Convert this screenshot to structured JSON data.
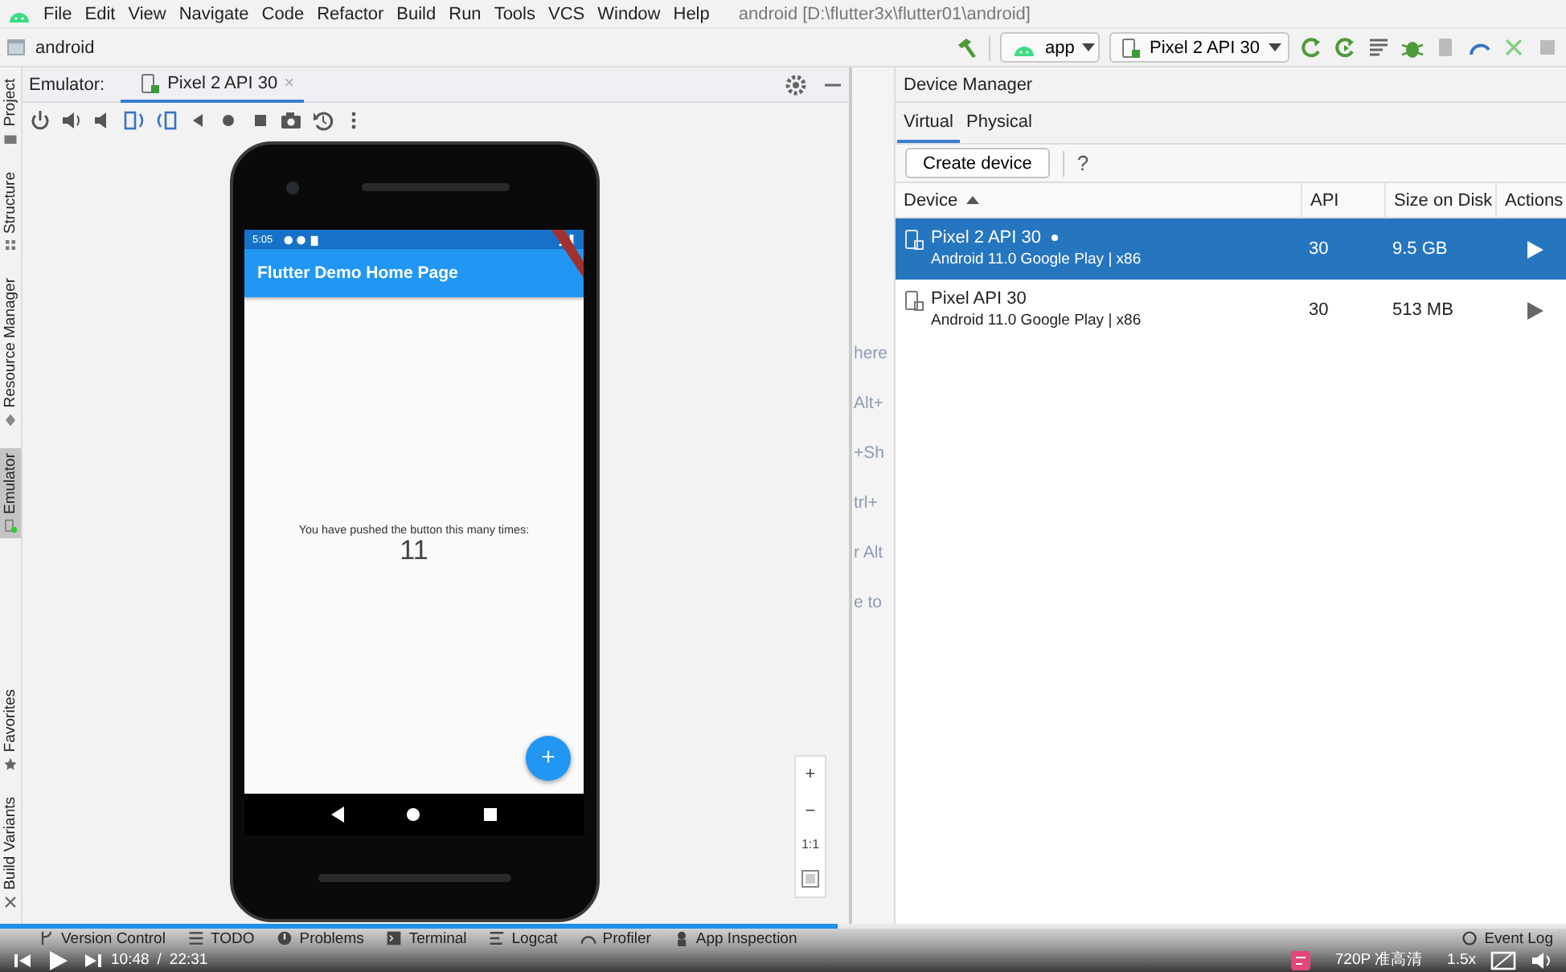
{
  "menu_bar": {
    "items": [
      "File",
      "Edit",
      "View",
      "Navigate",
      "Code",
      "Refactor",
      "Build",
      "Run",
      "Tools",
      "VCS",
      "Window",
      "Help"
    ],
    "title": "android [D:\\flutter3x\\flutter01\\android]"
  },
  "nav_bar": {
    "breadcrumb": "android",
    "run_config": "app",
    "device": "Pixel 2 API 30"
  },
  "left_stripe": {
    "top": [
      {
        "label": "Project",
        "selected": false
      },
      {
        "label": "Structure",
        "selected": false
      },
      {
        "label": "Resource Manager",
        "selected": false
      },
      {
        "label": "Emulator",
        "selected": true
      }
    ],
    "bottom": [
      {
        "label": "Favorites",
        "selected": false
      },
      {
        "label": "Build Variants",
        "selected": false
      }
    ]
  },
  "emulator": {
    "label": "Emulator:",
    "tab": "Pixel 2 API 30",
    "tab_close": "×",
    "zoom_controls": [
      "+",
      "−",
      "1:1"
    ],
    "phone": {
      "status_time": "5:05",
      "app_title": "Flutter Demo Home Page",
      "message": "You have pushed the button this many times:",
      "counter": "11",
      "fab": "+"
    }
  },
  "editor_hints": [
    "here",
    "Alt+",
    "+Sh",
    "trl+",
    "r Alt",
    "e to"
  ],
  "device_manager": {
    "title": "Device Manager",
    "tabs": [
      {
        "label": "Virtual",
        "selected": true
      },
      {
        "label": "Physical",
        "selected": false
      }
    ],
    "create_button": "Create device",
    "help": "?",
    "columns": [
      "Device",
      "API",
      "Size on Disk",
      "Actions"
    ],
    "rows": [
      {
        "name": "Pixel 2 API 30",
        "detail": "Android 11.0 Google Play | x86",
        "api": "30",
        "size": "9.5 GB",
        "selected": true,
        "running": true
      },
      {
        "name": "Pixel API 30",
        "detail": "Android 11.0 Google Play | x86",
        "api": "30",
        "size": "513 MB",
        "selected": false,
        "running": false
      }
    ]
  },
  "tool_bar": {
    "tools": [
      "Version Control",
      "TODO",
      "Problems",
      "Terminal",
      "Logcat",
      "Profiler",
      "App Inspection"
    ],
    "event_log": "Event Log"
  },
  "player": {
    "time": "10:48",
    "separator": "/",
    "duration": "22:31",
    "level": 0.535,
    "quality": "720P 准高清",
    "speed": "1.5x"
  }
}
